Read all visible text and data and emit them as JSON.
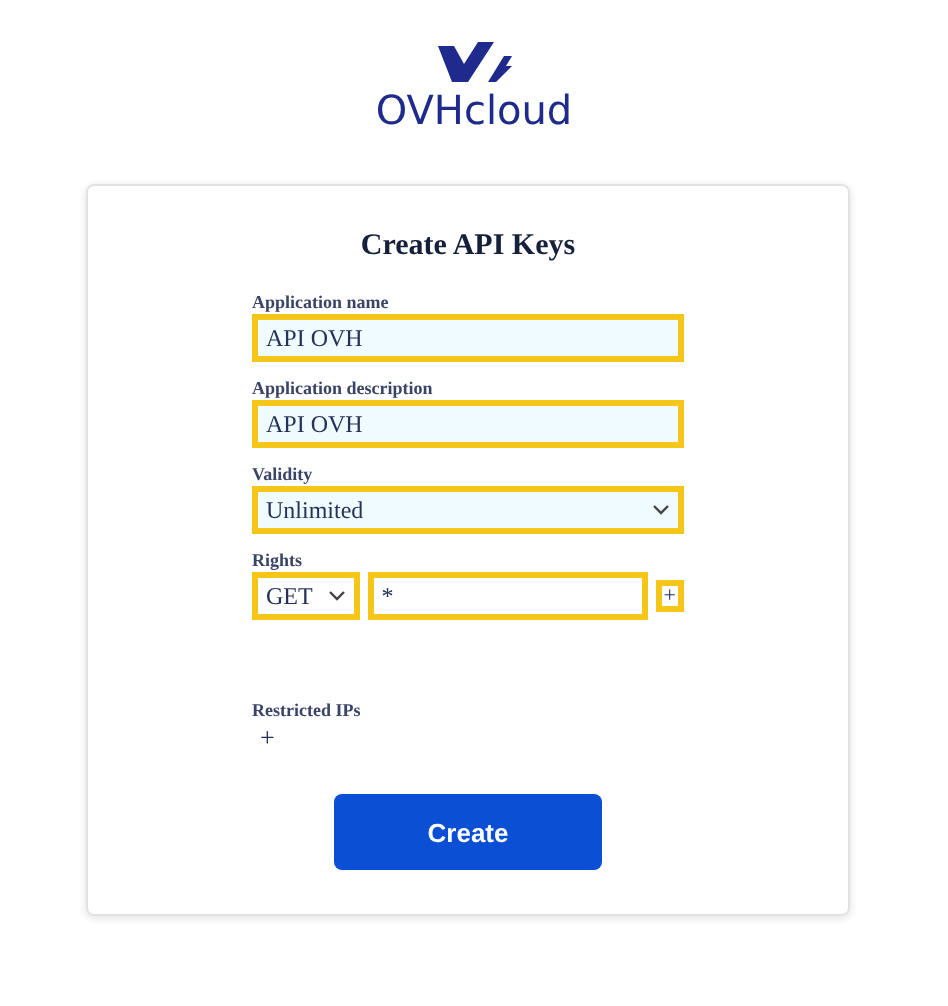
{
  "logo": {
    "text": "OVHcloud"
  },
  "form": {
    "title": "Create API Keys",
    "fields": [
      {
        "kind": "text",
        "label": "Application name",
        "value": "API OVH"
      },
      {
        "kind": "text",
        "label": "Application description",
        "value": "API OVH"
      },
      {
        "kind": "select",
        "label": "Validity",
        "value": "Unlimited"
      }
    ],
    "rights": {
      "label": "Rights",
      "method": "GET",
      "path": "*",
      "add": "+"
    },
    "restricted_ips": {
      "label": "Restricted IPs",
      "add": "+"
    },
    "submit": "Create"
  }
}
